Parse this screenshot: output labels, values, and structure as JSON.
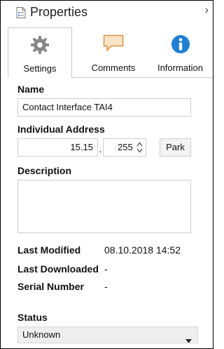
{
  "panel": {
    "title": "Properties",
    "chevron": "›"
  },
  "tabs": [
    {
      "label": "Settings",
      "icon": "gear-icon",
      "active": true
    },
    {
      "label": "Comments",
      "icon": "comment-icon",
      "active": false
    },
    {
      "label": "Information",
      "icon": "info-icon",
      "active": false
    }
  ],
  "fields": {
    "name_label": "Name",
    "name_value": "Contact Interface TAI4",
    "address_label": "Individual Address",
    "address_main": "15.15",
    "address_sep": ".",
    "address_device": "255",
    "park_label": "Park",
    "description_label": "Description",
    "description_value": "",
    "last_modified_label": "Last Modified",
    "last_modified_value": "08.10.2018 14:52",
    "last_downloaded_label": "Last Downloaded",
    "last_downloaded_value": "-",
    "serial_label": "Serial Number",
    "serial_value": "-",
    "status_label": "Status",
    "status_value": "Unknown"
  },
  "colors": {
    "gear": "#8a8a8a",
    "comment_fill": "#fbe4c8",
    "comment_stroke": "#e0913f",
    "info_blue": "#1e7fd6",
    "select_bg": "#eeeeee"
  }
}
